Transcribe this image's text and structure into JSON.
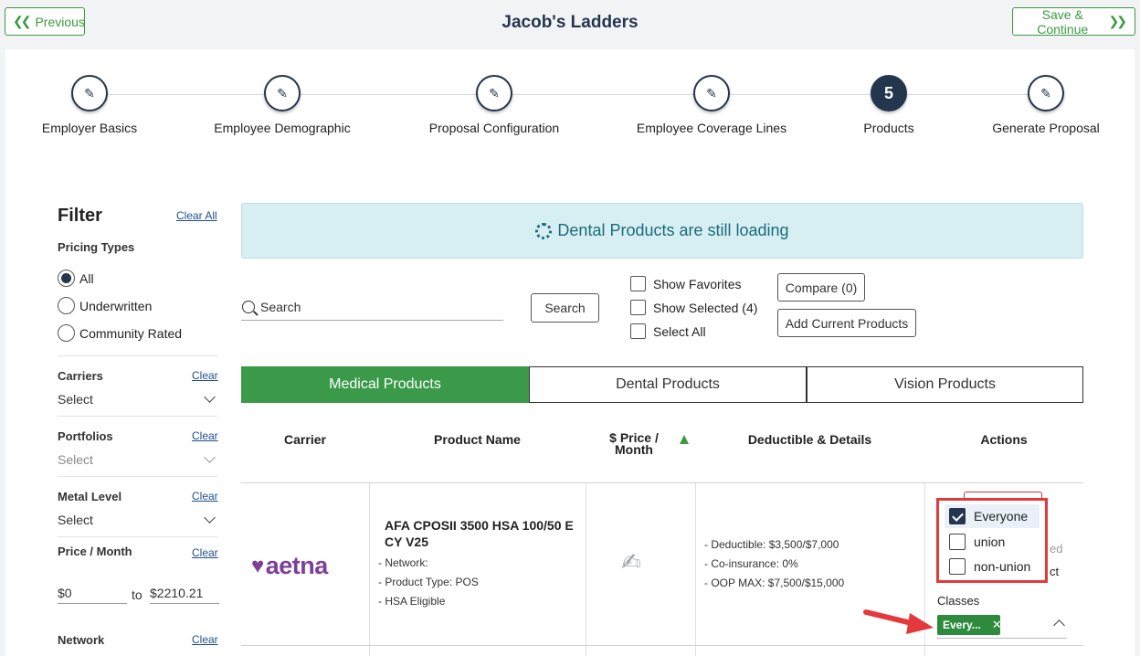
{
  "header": {
    "previous_label": "Previous",
    "title": "Jacob's Ladders",
    "save_label": "Save & Continue"
  },
  "stepper": {
    "steps": [
      {
        "label": "Employer Basics",
        "state": "done"
      },
      {
        "label": "Employee Demographic",
        "state": "done"
      },
      {
        "label": "Proposal Configuration",
        "state": "done"
      },
      {
        "label": "Employee Coverage Lines",
        "state": "done"
      },
      {
        "label": "Products",
        "state": "active",
        "number": "5"
      },
      {
        "label": "Generate Proposal",
        "state": "done"
      }
    ]
  },
  "filter": {
    "title": "Filter",
    "clear_all": "Clear All",
    "pricing_types_label": "Pricing Types",
    "pricing_types": [
      "All",
      "Underwritten",
      "Community Rated"
    ],
    "pricing_selected": "All",
    "clear": "Clear",
    "carriers": {
      "label": "Carriers",
      "value": "Select"
    },
    "portfolios": {
      "label": "Portfolios",
      "value": "Select"
    },
    "metal_level": {
      "label": "Metal Level",
      "value": "Select"
    },
    "price_month": {
      "label": "Price / Month",
      "min_prefix": "$",
      "min": "0",
      "to": "to",
      "max_prefix": "$",
      "max": "2210.21"
    },
    "network": {
      "label": "Network"
    }
  },
  "banner": {
    "text": "Dental Products are still loading"
  },
  "search": {
    "placeholder": "Search",
    "button": "Search"
  },
  "options": {
    "show_favorites": "Show Favorites",
    "show_selected": "Show Selected (4)",
    "select_all": "Select All",
    "compare": "Compare (0)",
    "add_current": "Add Current Products"
  },
  "tabs": {
    "medical": "Medical Products",
    "dental": "Dental Products",
    "vision": "Vision Products",
    "active": "medical"
  },
  "table": {
    "headers": {
      "carrier": "Carrier",
      "product_name": "Product Name",
      "price_line1": "$ Price /",
      "price_line2": "Month",
      "deductible": "Deductible & Details",
      "actions": "Actions"
    },
    "rows": [
      {
        "carrier_logo": "aetna",
        "product_name": "AFA CPOSII 3500 HSA 100/50 E CY V25",
        "details": [
          "- Network:",
          "- Product Type: POS",
          "- HSA Eligible"
        ],
        "price_icon": "signature-icon",
        "deductible_details": [
          "- Deductible: $3,500/$7,000",
          "- Co-insurance: 0%",
          "- OOP MAX: $7,500/$15,000"
        ],
        "hidden_text_1": "ed",
        "hidden_text_2": "ct",
        "classes_label": "Classes",
        "class_chip": "Every...",
        "class_options": [
          {
            "label": "Everyone",
            "checked": true
          },
          {
            "label": "union",
            "checked": false
          },
          {
            "label": "non-union",
            "checked": false
          }
        ]
      }
    ]
  },
  "colors": {
    "navy": "#24354e",
    "green": "#3a9a3f",
    "banner_bg": "#d7eff3",
    "highlight_red": "#e5383b",
    "aetna_purple": "#7d3f98"
  }
}
